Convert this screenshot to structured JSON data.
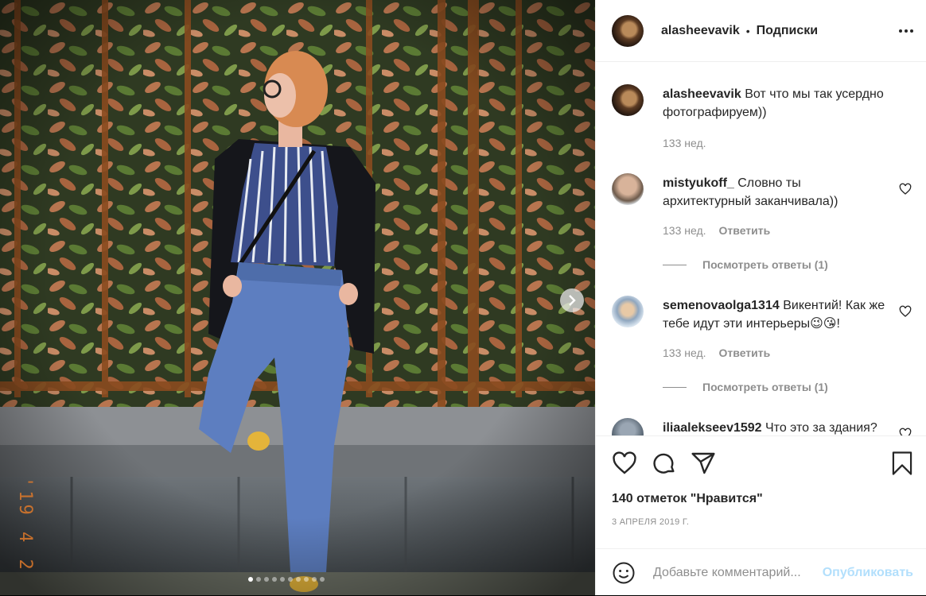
{
  "post": {
    "username": "alasheevavik",
    "separator": "•",
    "follow_label": "Подписки",
    "more_icon": "more-dots-icon"
  },
  "caption": {
    "username": "alasheevavik",
    "text": "Вот что мы так усердно фотографируем))",
    "time": "133 нед."
  },
  "comments": [
    {
      "username": "mistyukoff_",
      "text": "Словно ты архитектурный заканчивала))",
      "time": "133 нед.",
      "reply_label": "Ответить",
      "view_replies": "Посмотреть ответы (1)"
    },
    {
      "username": "semenovaolga1314",
      "text": "Викентий! Как же тебе идут эти интерьеры😉😘!",
      "time": "133 нед.",
      "reply_label": "Ответить",
      "view_replies": "Посмотреть ответы (1)"
    },
    {
      "username": "iliaalekseev1592",
      "text": "Что это за здания?"
    }
  ],
  "photo": {
    "date_stamp": "'19 4 2",
    "carousel_total": 10,
    "carousel_active": 0
  },
  "actions": {
    "likes_text": "140 отметок \"Нравится\"",
    "date": "3 АПРЕЛЯ 2019 Г."
  },
  "comment_box": {
    "placeholder": "Добавьте комментарий...",
    "publish_label": "Опубликовать"
  },
  "colors": {
    "text": "#262626",
    "secondary": "#8e8e8e",
    "publish_disabled": "#b2dffc",
    "divider": "#efefef"
  }
}
